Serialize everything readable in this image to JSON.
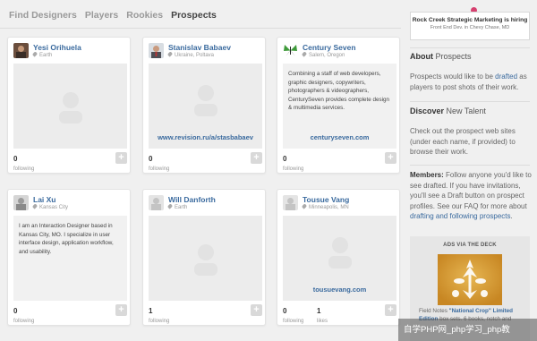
{
  "nav": {
    "items": [
      "Find Designers",
      "Players",
      "Rookies",
      "Prospects"
    ],
    "active": "Prospects"
  },
  "cards": [
    {
      "name": "Yesi Orihuela",
      "location": "Earth",
      "desc": "",
      "link": "",
      "stats": [
        {
          "num": "0",
          "label": "following"
        }
      ]
    },
    {
      "name": "Stanislav Babaev",
      "location": "Ukraine, Poltava",
      "desc": "",
      "link": "www.revision.ru/a/stasbabaev",
      "stats": [
        {
          "num": "0",
          "label": "following"
        }
      ]
    },
    {
      "name": "Century Seven",
      "location": "Salem, Oregon",
      "desc": "Combining a staff of web developers, graphic designers, copywriters, photographers & videographers, CenturySeven provides complete design & multimedia services.",
      "link": "centuryseven.com",
      "stats": [
        {
          "num": "0",
          "label": "following"
        }
      ]
    },
    {
      "name": "Lai Xu",
      "location": "Kansas City",
      "desc": "I am an Interaction Designer based in Kansas City, MO. I specialize in user interface design, application workflow, and usability.",
      "link": "",
      "stats": [
        {
          "num": "0",
          "label": "following"
        }
      ]
    },
    {
      "name": "Will Danforth",
      "location": "Earth",
      "desc": "",
      "link": "",
      "stats": [
        {
          "num": "1",
          "label": "following"
        }
      ]
    },
    {
      "name": "Tousue Vang",
      "location": "Minneapolis, MN",
      "desc": "",
      "link": "tousuevang.com",
      "stats": [
        {
          "num": "0",
          "label": "following"
        },
        {
          "num": "1",
          "label": "likes"
        }
      ]
    }
  ],
  "plus_label": "+",
  "sidebar": {
    "promo_title": "Rock Creek Strategic Marketing is hiring",
    "promo_sub": "Front End Dev. in Chevy Chase, MD",
    "about_bold": "About",
    "about_rest": " Prospects",
    "about_p1": "Prospects would like to be ",
    "about_link": "drafted",
    "about_p2": " as players to post shots of their work.",
    "discover_bold": "Discover",
    "discover_rest": " New Talent",
    "discover_text": "Check out the prospect web sites (under each name, if provided) to browse their work.",
    "members_bold": "Members:",
    "members_text": " Follow anyone you'd like to see drafted. If you have invitations, you'll see a Draft button on prospect profiles. See our FAQ for more about ",
    "members_link": "drafting and following prospects",
    "members_end": ".",
    "ads_header": "ADS VIA THE DECK",
    "ads_cap1": "Field Notes ",
    "ads_cap_link": "\"National Crop\" Limited Edition",
    "ads_cap2": " box sets. 6 books, notch and"
  },
  "watermark": "自学PHP网_php学习_php教",
  "colors": {
    "link": "#3a6a9e",
    "pin": "#d6406f"
  }
}
